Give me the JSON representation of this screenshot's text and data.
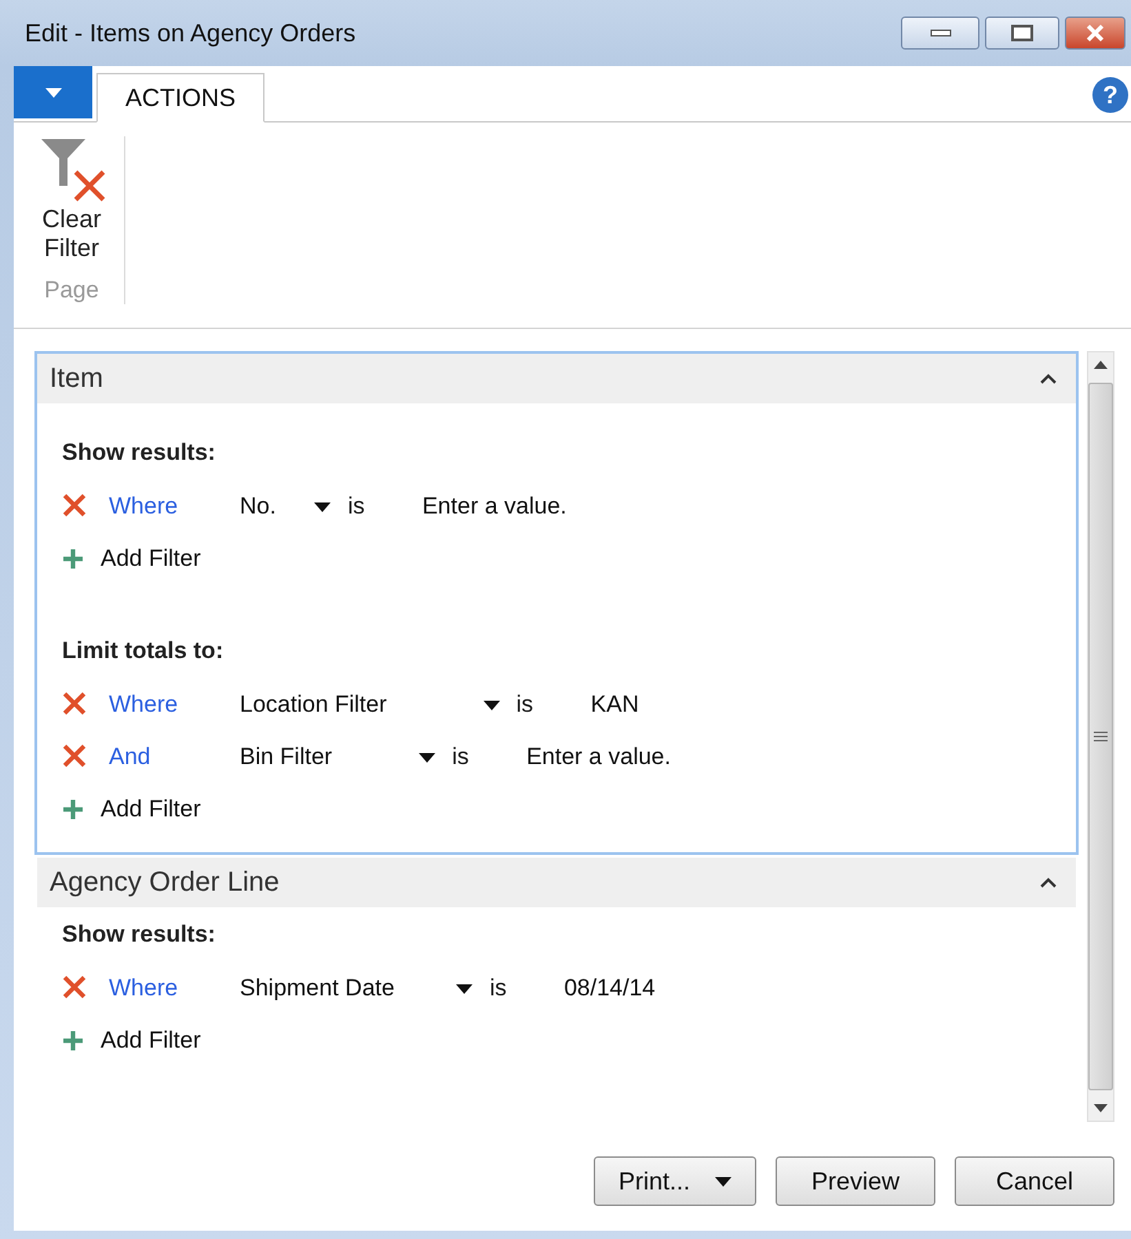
{
  "window": {
    "title": "Edit - Items on Agency Orders"
  },
  "tabs": [
    {
      "label": "ACTIONS",
      "selected": true
    }
  ],
  "help": {
    "label": "?"
  },
  "ribbon": {
    "actions": [
      {
        "label": "Clear Filter"
      }
    ],
    "group_label": "Page"
  },
  "sections": [
    {
      "title": "Item",
      "focused": true,
      "expanded": true,
      "groups": [
        {
          "heading": "Show results:",
          "filters": [
            {
              "connector": "Where",
              "field": "No.",
              "operator": "is",
              "placeholder": "Enter a value."
            }
          ],
          "add_label": "Add Filter"
        },
        {
          "heading": "Limit totals to:",
          "filters": [
            {
              "connector": "Where",
              "field": "Location Filter",
              "operator": "is",
              "value": "KAN"
            },
            {
              "connector": "And",
              "field": "Bin Filter",
              "operator": "is",
              "placeholder": "Enter a value."
            }
          ],
          "add_label": "Add Filter"
        }
      ]
    },
    {
      "title": "Agency Order Line",
      "focused": false,
      "expanded": true,
      "groups": [
        {
          "heading": "Show results:",
          "filters": [
            {
              "connector": "Where",
              "field": "Shipment Date",
              "operator": "is",
              "value": "08/14/14"
            }
          ],
          "add_label": "Add Filter"
        }
      ]
    }
  ],
  "buttons": [
    {
      "label": "Print...",
      "kind": "split"
    },
    {
      "label": "Preview",
      "kind": "plain"
    },
    {
      "label": "Cancel",
      "kind": "plain"
    }
  ]
}
